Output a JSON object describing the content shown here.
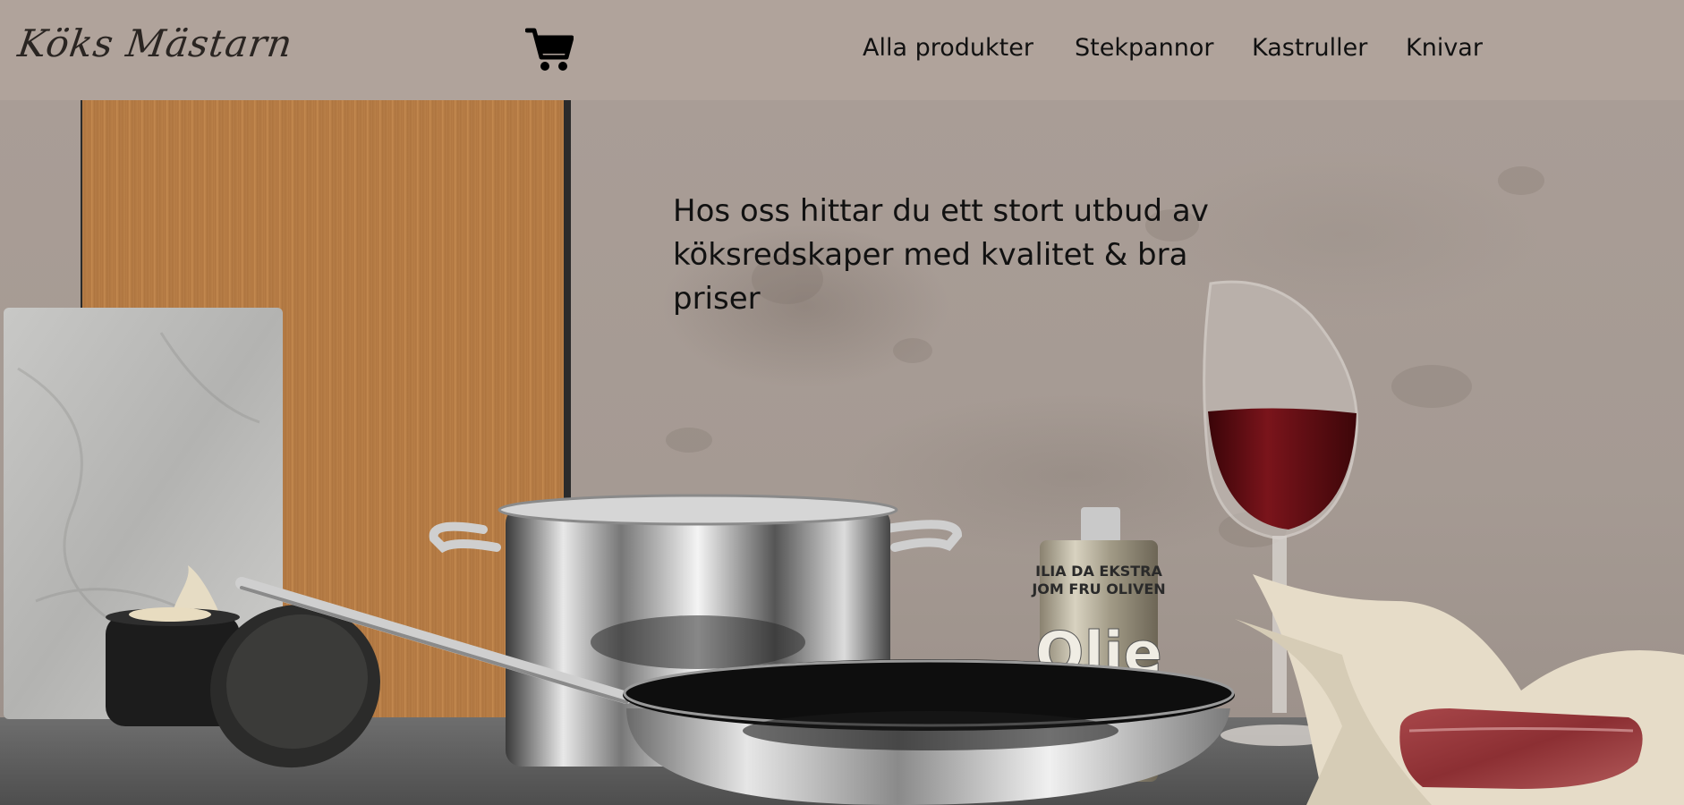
{
  "header": {
    "logo_text": "Köks Mästarn",
    "cart_icon": "shopping-cart-icon",
    "nav": [
      {
        "label": "Alla produkter"
      },
      {
        "label": "Stekpannor"
      },
      {
        "label": "Kastruller"
      },
      {
        "label": "Knivar"
      }
    ]
  },
  "hero": {
    "tagline": "Hos oss hittar du ett stort utbud av köksredskaper med kvalitet & bra priser",
    "can_label_line1": "ILIA DA EKSTRA",
    "can_label_line2": "JOM FRU OLIVEN",
    "can_label_big": "Olie"
  },
  "colors": {
    "header_bg": "#b0a39b",
    "wall": "#a99d96",
    "text": "#111111",
    "wine": "#6a0f14"
  }
}
